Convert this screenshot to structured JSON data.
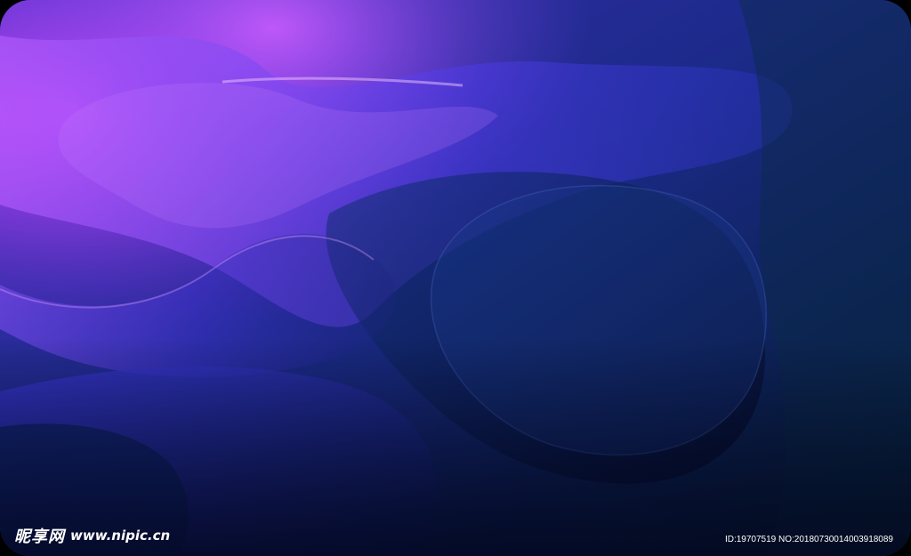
{
  "image": {
    "subject": "abstract purple and blue flowing wave background",
    "colors": {
      "magenta": "#d64bff",
      "violet": "#6a2bd8",
      "royal_blue": "#2a2bc4",
      "navy": "#0d1f5c",
      "deep_navy": "#07103a",
      "teal_dark": "#0c3a5a",
      "frame": "#000000"
    }
  },
  "watermark": {
    "logo_text": "昵享网",
    "url_text": "www.nipic.cn"
  },
  "footer": {
    "id_text": "ID:19707519 NO:20180730014003918089"
  }
}
